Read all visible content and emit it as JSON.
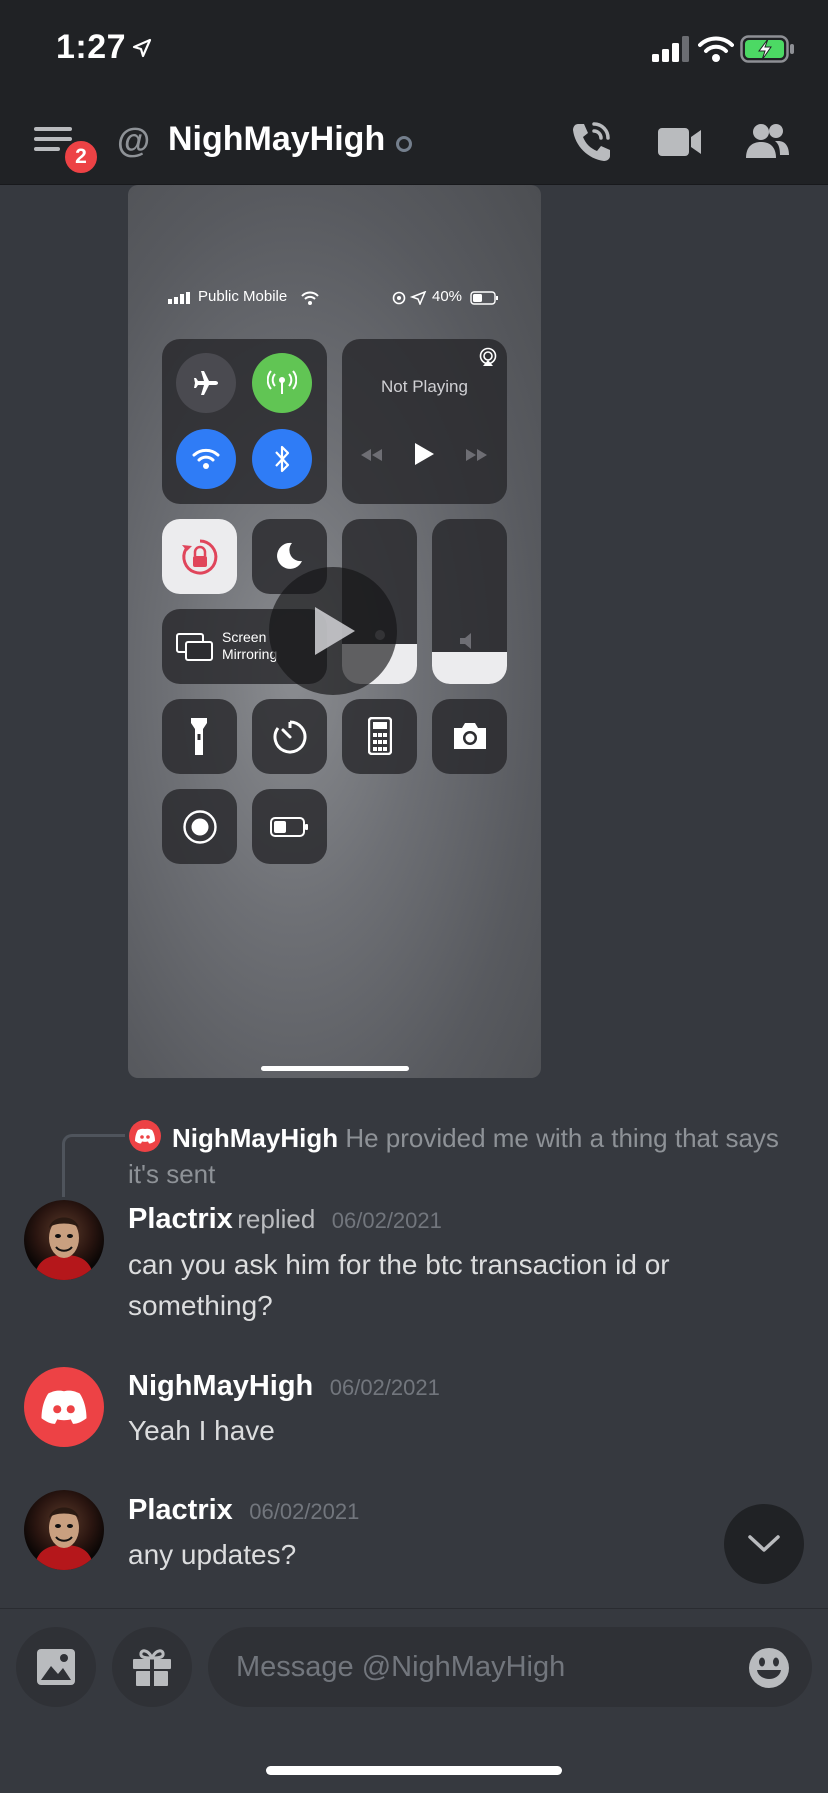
{
  "status_bar": {
    "time": "1:27"
  },
  "header": {
    "channel_name": "NighMayHigh",
    "notification_count": "2"
  },
  "embedded_screenshot": {
    "carrier": "Public Mobile",
    "battery": "40%",
    "now_playing": "Not Playing",
    "screen_mirroring_line1": "Screen",
    "screen_mirroring_line2": "Mirroring"
  },
  "reply_preview": {
    "username": "NighMayHigh",
    "text_line1": "He provided me with a thing that says",
    "text_line2": "it's sent"
  },
  "messages": [
    {
      "username": "Plactrix",
      "replied": "replied",
      "timestamp": "06/02/2021",
      "line1": "can you ask him for the btc transaction id or",
      "line2": "something?"
    },
    {
      "username": "NighMayHigh",
      "timestamp": "06/02/2021",
      "line1": "Yeah I have"
    },
    {
      "username": "Plactrix",
      "timestamp": "06/02/2021",
      "line1": "any updates?"
    }
  ],
  "composer": {
    "placeholder": "Message @NighMayHigh"
  },
  "colors": {
    "background": "#36393f",
    "header": "#202225",
    "accent_red": "#ed4245",
    "blurple": "#5865f2"
  }
}
